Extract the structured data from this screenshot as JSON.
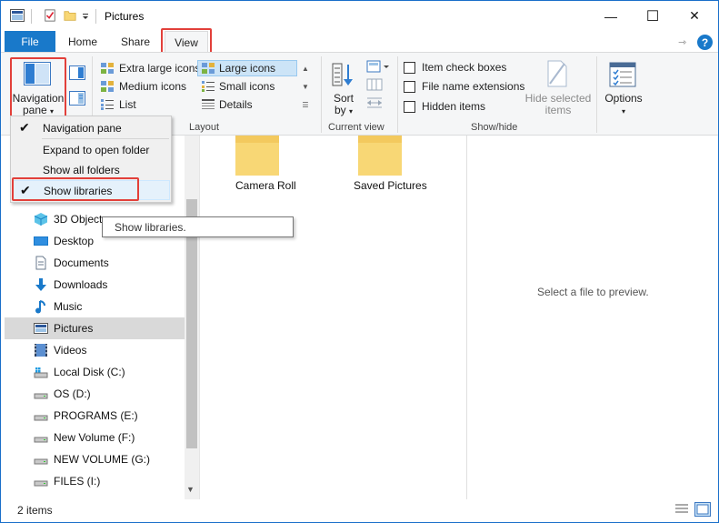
{
  "window": {
    "title": "Pictures",
    "minimize_glyph": "—",
    "maximize_glyph": "☐",
    "close_glyph": "✕"
  },
  "tabs": {
    "file": "File",
    "home": "Home",
    "share": "Share",
    "view": "View",
    "help_glyph": "?"
  },
  "ribbon": {
    "panes": {
      "navigation_pane_label_1": "Navigation",
      "navigation_pane_label_2": "pane"
    },
    "layout": {
      "label": "Layout",
      "items": [
        "Extra large icons",
        "Large icons",
        "Medium icons",
        "Small icons",
        "List",
        "Details"
      ],
      "selected": "Large icons"
    },
    "current_view": {
      "label": "Current view",
      "sort_by_1": "Sort",
      "sort_by_2": "by"
    },
    "show_hide": {
      "label": "Show/hide",
      "item_check_boxes": "Item check boxes",
      "file_name_extensions": "File name extensions",
      "hidden_items": "Hidden items",
      "hide_selected_1": "Hide selected",
      "hide_selected_2": "items"
    },
    "options": "Options"
  },
  "menu": {
    "items": [
      {
        "label": "Navigation pane",
        "checked": true
      },
      {
        "label": "Expand to open folder",
        "checked": false
      },
      {
        "label": "Show all folders",
        "checked": false
      },
      {
        "label": "Show libraries",
        "checked": true
      }
    ],
    "check_glyph": "✔"
  },
  "tooltip": "Show libraries.",
  "nav": {
    "items": [
      "3D Objects",
      "Desktop",
      "Documents",
      "Downloads",
      "Music",
      "Pictures",
      "Videos",
      "Local Disk (C:)",
      "OS (D:)",
      "PROGRAMS (E:)",
      "New Volume (F:)",
      "NEW VOLUME (G:)",
      "FILES (I:)"
    ],
    "selected": "Pictures"
  },
  "folders": [
    "Camera Roll",
    "Saved Pictures"
  ],
  "preview": "Select a file to preview.",
  "status": "2 items",
  "colors": {
    "accent": "#1979ca",
    "highlight": "#e2403a",
    "folder": "#f8d775"
  }
}
